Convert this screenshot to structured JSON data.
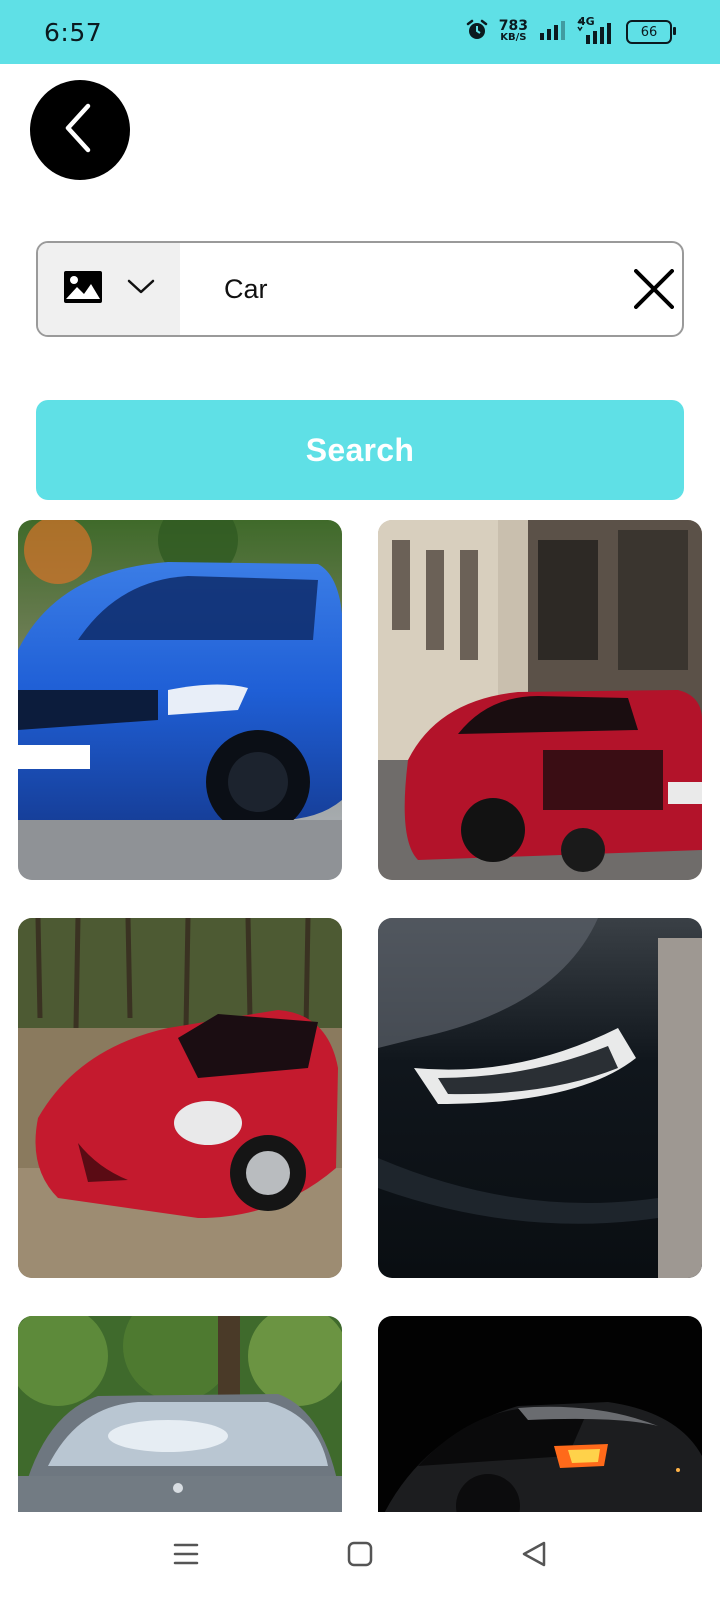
{
  "status_bar": {
    "time": "6:57",
    "net_speed_value": "783",
    "net_speed_unit": "KB/S",
    "network_type": "4G",
    "battery_level": "66"
  },
  "search": {
    "type_icon": "image-icon",
    "query": "Car",
    "button_label": "Search"
  },
  "results": {
    "images": [
      {
        "subject": "blue BMW sedan"
      },
      {
        "subject": "red sports car on street"
      },
      {
        "subject": "red sports car on road"
      },
      {
        "subject": "black car headlight close-up"
      },
      {
        "subject": "silver car front"
      },
      {
        "subject": "dark car in shadow"
      }
    ]
  },
  "colors": {
    "accent": "#5fe0e6",
    "button_text": "#ffffff"
  }
}
